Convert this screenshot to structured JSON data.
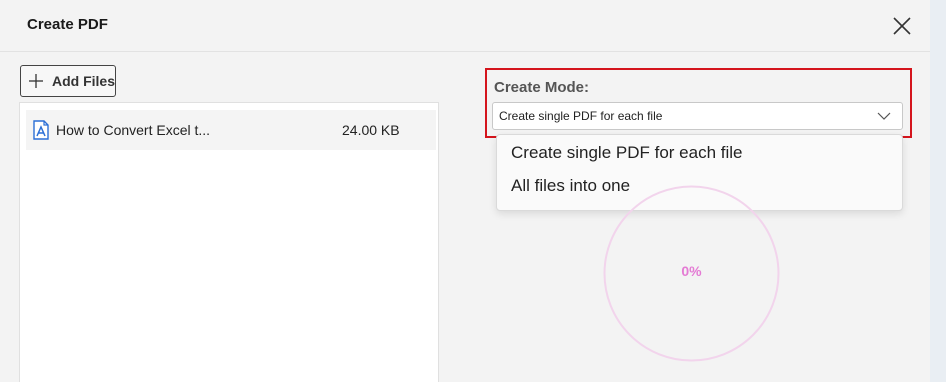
{
  "dialog": {
    "title": "Create PDF",
    "close_icon": "close-icon"
  },
  "toolbar": {
    "add_files_label": "Add Files",
    "add_icon": "plus-icon"
  },
  "files": [
    {
      "name": "How to Convert Excel t...",
      "size": "24.00 KB",
      "icon": "pdf-file-icon"
    }
  ],
  "create_mode": {
    "label": "Create Mode:",
    "selected": "Create single PDF for each file",
    "options": [
      "Create single PDF for each file",
      "All files into one"
    ]
  },
  "progress": {
    "text": "0%",
    "value": 0
  },
  "colors": {
    "highlight_border": "#d4141c",
    "progress_ring": "#f2d4ec",
    "progress_text": "#e47bd4",
    "file_icon": "#2b6fd6"
  }
}
